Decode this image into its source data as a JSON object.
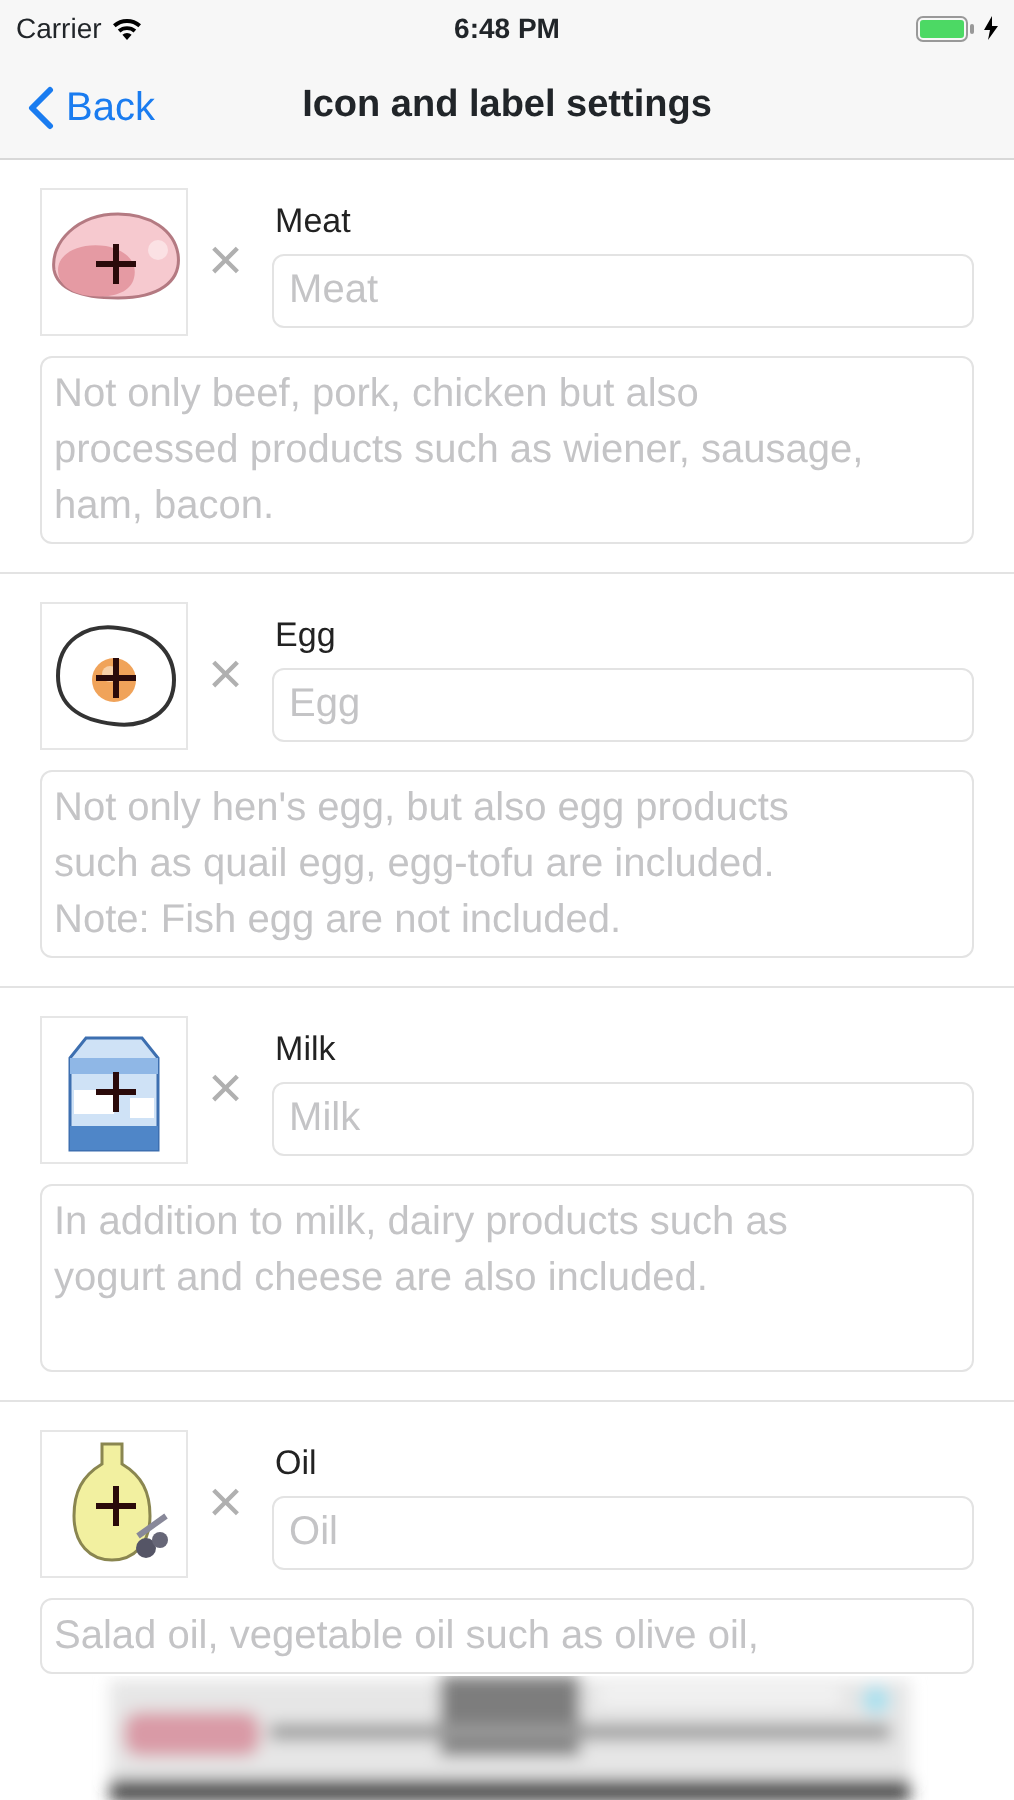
{
  "status_bar": {
    "carrier": "Carrier",
    "time": "6:48 PM",
    "charging": true
  },
  "nav": {
    "back": "Back",
    "title": "Icon and label settings"
  },
  "items": [
    {
      "label": "Meat",
      "placeholder": "Meat",
      "description_placeholder": "Not only beef, pork, chicken but also processed products such as wiener, sausage, ham, bacon.",
      "remove": "×"
    },
    {
      "label": "Egg",
      "placeholder": "Egg",
      "description_placeholder": "Not only hen's egg, but also egg products such as quail egg, egg-tofu are included. Note: Fish egg are not included.",
      "remove": "×"
    },
    {
      "label": "Milk",
      "placeholder": "Milk",
      "description_placeholder": "In addition to milk, dairy products such as yogurt and cheese are also included.",
      "remove": "×"
    },
    {
      "label": "Oil",
      "placeholder": "Oil",
      "description_placeholder": "Salad oil, vegetable oil such as olive oil,",
      "remove": "×"
    }
  ]
}
